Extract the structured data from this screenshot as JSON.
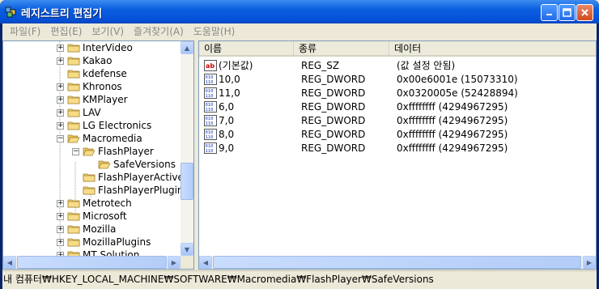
{
  "window": {
    "title": "레지스트리 편집기"
  },
  "menu": [
    "파일(F)",
    "편집(E)",
    "보기(V)",
    "즐겨찾기(A)",
    "도움말(H)"
  ],
  "tree": [
    {
      "label": "InterVideo",
      "exp": "+",
      "depth": 0
    },
    {
      "label": "Kakao",
      "exp": "+",
      "depth": 0
    },
    {
      "label": "kdefense",
      "exp": "",
      "depth": 0
    },
    {
      "label": "Khronos",
      "exp": "+",
      "depth": 0
    },
    {
      "label": "KMPlayer",
      "exp": "+",
      "depth": 0
    },
    {
      "label": "LAV",
      "exp": "+",
      "depth": 0
    },
    {
      "label": "LG Electronics",
      "exp": "+",
      "depth": 0
    },
    {
      "label": "Macromedia",
      "exp": "−",
      "depth": 0,
      "open": true
    },
    {
      "label": "FlashPlayer",
      "exp": "−",
      "depth": 1,
      "open": true
    },
    {
      "label": "SafeVersions",
      "exp": "",
      "depth": 2,
      "open": true
    },
    {
      "label": "FlashPlayerActiveX",
      "exp": "",
      "depth": 1
    },
    {
      "label": "FlashPlayerPlugin",
      "exp": "",
      "depth": 1
    },
    {
      "label": "Metrotech",
      "exp": "+",
      "depth": 0
    },
    {
      "label": "Microsoft",
      "exp": "+",
      "depth": 0
    },
    {
      "label": "Mozilla",
      "exp": "+",
      "depth": 0
    },
    {
      "label": "MozillaPlugins",
      "exp": "+",
      "depth": 0
    },
    {
      "label": "MT Solution",
      "exp": "+",
      "depth": 0
    }
  ],
  "columns": {
    "name": "이름",
    "type": "종류",
    "data": "데이터"
  },
  "values": [
    {
      "name": "(기본값)",
      "type": "REG_SZ",
      "data": "(값 설정 안됨)",
      "icon": "string"
    },
    {
      "name": "10,0",
      "type": "REG_DWORD",
      "data": "0x00e6001e (15073310)",
      "icon": "binary"
    },
    {
      "name": "11,0",
      "type": "REG_DWORD",
      "data": "0x0320005e (52428894)",
      "icon": "binary"
    },
    {
      "name": "6,0",
      "type": "REG_DWORD",
      "data": "0xffffffff (4294967295)",
      "icon": "binary"
    },
    {
      "name": "7,0",
      "type": "REG_DWORD",
      "data": "0xffffffff (4294967295)",
      "icon": "binary"
    },
    {
      "name": "8,0",
      "type": "REG_DWORD",
      "data": "0xffffffff (4294967295)",
      "icon": "binary"
    },
    {
      "name": "9,0",
      "type": "REG_DWORD",
      "data": "0xffffffff (4294967295)",
      "icon": "binary"
    }
  ],
  "status": "내 컴퓨터₩HKEY_LOCAL_MACHINE₩SOFTWARE₩Macromedia₩FlashPlayer₩SafeVersions"
}
